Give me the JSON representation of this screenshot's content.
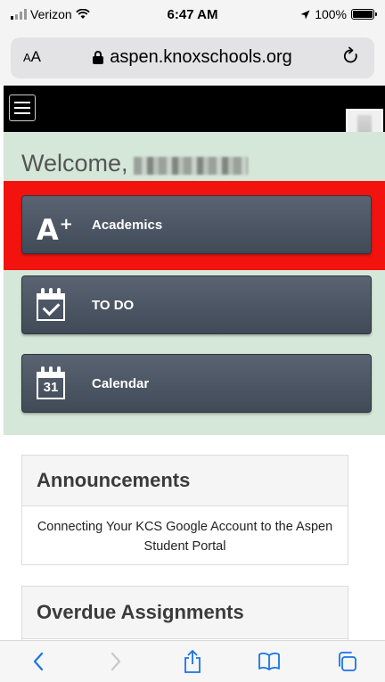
{
  "status_bar": {
    "carrier": "Verizon",
    "time": "6:47 AM",
    "battery": "100%",
    "battery_level": 1.0
  },
  "browser": {
    "text_size_label_small": "A",
    "text_size_label_large": "A",
    "url": "aspen.knoxschools.org",
    "reload_icon": "reload-icon"
  },
  "header": {
    "menu_icon": "hamburger-icon"
  },
  "welcome": {
    "greeting": "Welcome,"
  },
  "nav_buttons": [
    {
      "label": "Academics",
      "icon": "a-plus-icon",
      "highlighted": true
    },
    {
      "label": "TO DO",
      "icon": "calendar-check-icon"
    },
    {
      "label": "Calendar",
      "icon": "calendar-icon",
      "icon_text": "31"
    }
  ],
  "announcements": {
    "title": "Announcements",
    "items": [
      "Connecting Your KCS Google Account to the Aspen Student Portal"
    ]
  },
  "overdue": {
    "title": "Overdue Assignments"
  },
  "toolbar": {
    "items": [
      "back-icon",
      "forward-icon",
      "share-icon",
      "bookmarks-icon",
      "tabs-icon"
    ]
  },
  "colors": {
    "accent": "#1a73e8",
    "header_bg": "#000000",
    "welcome_bg": "#d5e7d8",
    "button_bg": "#4b5462",
    "highlight": "#f2130f"
  }
}
